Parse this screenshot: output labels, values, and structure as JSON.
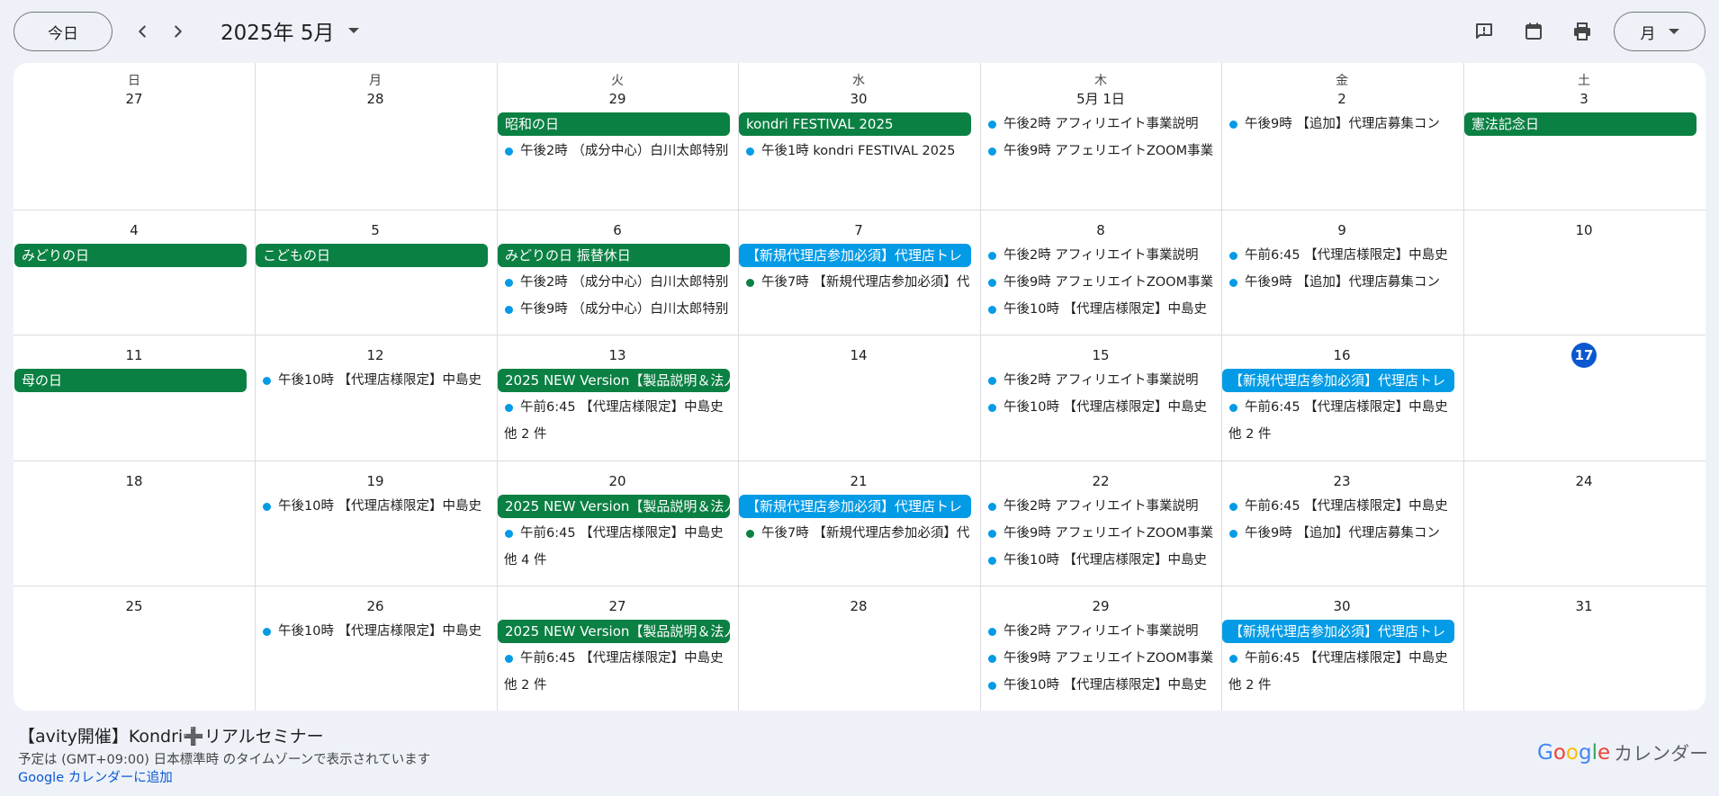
{
  "header": {
    "today_label": "今日",
    "month_label": "2025年 5月",
    "view_label": "月"
  },
  "weekdays": [
    "日",
    "月",
    "火",
    "水",
    "木",
    "金",
    "土"
  ],
  "weeks": [
    {
      "days": [
        {
          "num": "27",
          "chips": [],
          "events": []
        },
        {
          "num": "28",
          "chips": [],
          "events": []
        },
        {
          "num": "29",
          "chips": [
            {
              "text": "昭和の日",
              "color": "green"
            }
          ],
          "events": [
            {
              "text": "午後2時 （成分中心）白川太郎特别",
              "dot": "blue"
            }
          ]
        },
        {
          "num": "30",
          "chips": [
            {
              "text": "kondri FESTIVAL 2025",
              "color": "green"
            }
          ],
          "events": [
            {
              "text": "午後1時 kondri FESTIVAL 2025",
              "dot": "blue"
            }
          ]
        },
        {
          "num": "5月 1日",
          "chips": [],
          "events": [
            {
              "text": "午後2時 アフィリエイト事業説明",
              "dot": "blue"
            },
            {
              "text": "午後9時 アフェリエイトZOOM事業",
              "dot": "blue"
            }
          ]
        },
        {
          "num": "2",
          "chips": [],
          "events": [
            {
              "text": "午後9時 【追加】代理店募集コン",
              "dot": "blue"
            }
          ]
        },
        {
          "num": "3",
          "chips": [
            {
              "text": "憲法記念日",
              "color": "green"
            }
          ],
          "events": []
        }
      ]
    },
    {
      "days": [
        {
          "num": "4",
          "chips": [
            {
              "text": "みどりの日",
              "color": "green"
            }
          ],
          "events": []
        },
        {
          "num": "5",
          "chips": [
            {
              "text": "こどもの日",
              "color": "green"
            }
          ],
          "events": []
        },
        {
          "num": "6",
          "chips": [
            {
              "text": "みどりの日 振替休日",
              "color": "green"
            }
          ],
          "events": [
            {
              "text": "午後2時 （成分中心）白川太郎特别",
              "dot": "blue"
            },
            {
              "text": "午後9時 （成分中心）白川太郎特别",
              "dot": "blue"
            }
          ]
        },
        {
          "num": "7",
          "chips": [
            {
              "text": "【新規代理店参加必須】代理店トレ",
              "color": "blue"
            }
          ],
          "events": [
            {
              "text": "午後7時 【新規代理店参加必須】代",
              "dot": "green"
            }
          ]
        },
        {
          "num": "8",
          "chips": [],
          "events": [
            {
              "text": "午後2時 アフィリエイト事業説明",
              "dot": "blue"
            },
            {
              "text": "午後9時 アフェリエイトZOOM事業",
              "dot": "blue"
            },
            {
              "text": "午後10時 【代理店様限定】中島史",
              "dot": "blue"
            }
          ]
        },
        {
          "num": "9",
          "chips": [],
          "events": [
            {
              "text": "午前6:45 【代理店様限定】中島史",
              "dot": "blue"
            },
            {
              "text": "午後9時 【追加】代理店募集コン",
              "dot": "blue"
            }
          ]
        },
        {
          "num": "10",
          "chips": [],
          "events": []
        }
      ]
    },
    {
      "days": [
        {
          "num": "11",
          "chips": [
            {
              "text": "母の日",
              "color": "green"
            }
          ],
          "events": []
        },
        {
          "num": "12",
          "chips": [],
          "events": [
            {
              "text": "午後10時 【代理店様限定】中島史",
              "dot": "blue"
            }
          ]
        },
        {
          "num": "13",
          "chips": [
            {
              "text": "2025 NEW Version【製品説明＆法人",
              "color": "green"
            }
          ],
          "events": [
            {
              "text": "午前6:45 【代理店様限定】中島史",
              "dot": "blue"
            }
          ],
          "more": "他 2 件"
        },
        {
          "num": "14",
          "chips": [],
          "events": []
        },
        {
          "num": "15",
          "chips": [],
          "events": [
            {
              "text": "午後2時 アフィリエイト事業説明",
              "dot": "blue"
            },
            {
              "text": "午後10時 【代理店様限定】中島史",
              "dot": "blue"
            }
          ]
        },
        {
          "num": "16",
          "chips": [
            {
              "text": "【新規代理店参加必須】代理店トレ",
              "color": "blue"
            }
          ],
          "events": [
            {
              "text": "午前6:45 【代理店様限定】中島史",
              "dot": "blue"
            }
          ],
          "more": "他 2 件"
        },
        {
          "num": "17",
          "today": true,
          "chips": [],
          "events": []
        }
      ]
    },
    {
      "days": [
        {
          "num": "18",
          "chips": [],
          "events": []
        },
        {
          "num": "19",
          "chips": [],
          "events": [
            {
              "text": "午後10時 【代理店様限定】中島史",
              "dot": "blue"
            }
          ]
        },
        {
          "num": "20",
          "chips": [
            {
              "text": "2025 NEW Version【製品説明＆法人",
              "color": "green"
            }
          ],
          "events": [
            {
              "text": "午前6:45 【代理店様限定】中島史",
              "dot": "blue"
            }
          ],
          "more": "他 4 件"
        },
        {
          "num": "21",
          "chips": [
            {
              "text": "【新規代理店参加必須】代理店トレ",
              "color": "blue"
            }
          ],
          "events": [
            {
              "text": "午後7時 【新規代理店参加必須】代",
              "dot": "green"
            }
          ]
        },
        {
          "num": "22",
          "chips": [],
          "events": [
            {
              "text": "午後2時 アフィリエイト事業説明",
              "dot": "blue"
            },
            {
              "text": "午後9時 アフェリエイトZOOM事業",
              "dot": "blue"
            },
            {
              "text": "午後10時 【代理店様限定】中島史",
              "dot": "blue"
            }
          ]
        },
        {
          "num": "23",
          "chips": [],
          "events": [
            {
              "text": "午前6:45 【代理店様限定】中島史",
              "dot": "blue"
            },
            {
              "text": "午後9時 【追加】代理店募集コン",
              "dot": "blue"
            }
          ]
        },
        {
          "num": "24",
          "chips": [],
          "events": []
        }
      ]
    },
    {
      "days": [
        {
          "num": "25",
          "chips": [],
          "events": []
        },
        {
          "num": "26",
          "chips": [],
          "events": [
            {
              "text": "午後10時 【代理店様限定】中島史",
              "dot": "blue"
            }
          ]
        },
        {
          "num": "27",
          "chips": [
            {
              "text": "2025 NEW Version【製品説明＆法人",
              "color": "green"
            }
          ],
          "events": [
            {
              "text": "午前6:45 【代理店様限定】中島史",
              "dot": "blue"
            }
          ],
          "more": "他 2 件"
        },
        {
          "num": "28",
          "chips": [],
          "events": []
        },
        {
          "num": "29",
          "chips": [],
          "events": [
            {
              "text": "午後2時 アフィリエイト事業説明",
              "dot": "blue"
            },
            {
              "text": "午後9時 アフェリエイトZOOM事業",
              "dot": "blue"
            },
            {
              "text": "午後10時 【代理店様限定】中島史",
              "dot": "blue"
            }
          ]
        },
        {
          "num": "30",
          "chips": [
            {
              "text": "【新規代理店参加必須】代理店トレ",
              "color": "blue"
            }
          ],
          "events": [
            {
              "text": "午前6:45 【代理店様限定】中島史",
              "dot": "blue"
            }
          ],
          "more": "他 2 件"
        },
        {
          "num": "31",
          "chips": [],
          "events": []
        }
      ]
    }
  ],
  "footer": {
    "title": "【avity開催】Kondri➕リアルセミナー",
    "timezone": "予定は (GMT+09:00) 日本標準時 のタイムゾーンで表示されています",
    "add_link": "Google カレンダーに追加",
    "logo_letters": [
      "G",
      "o",
      "o",
      "g",
      "l",
      "e"
    ],
    "logo_suffix": "カレンダー"
  },
  "colors": {
    "chip_green": "#0b8043",
    "chip_blue": "#039be5",
    "today_accent": "#0b57d0",
    "page_bg": "#eef2f8"
  }
}
